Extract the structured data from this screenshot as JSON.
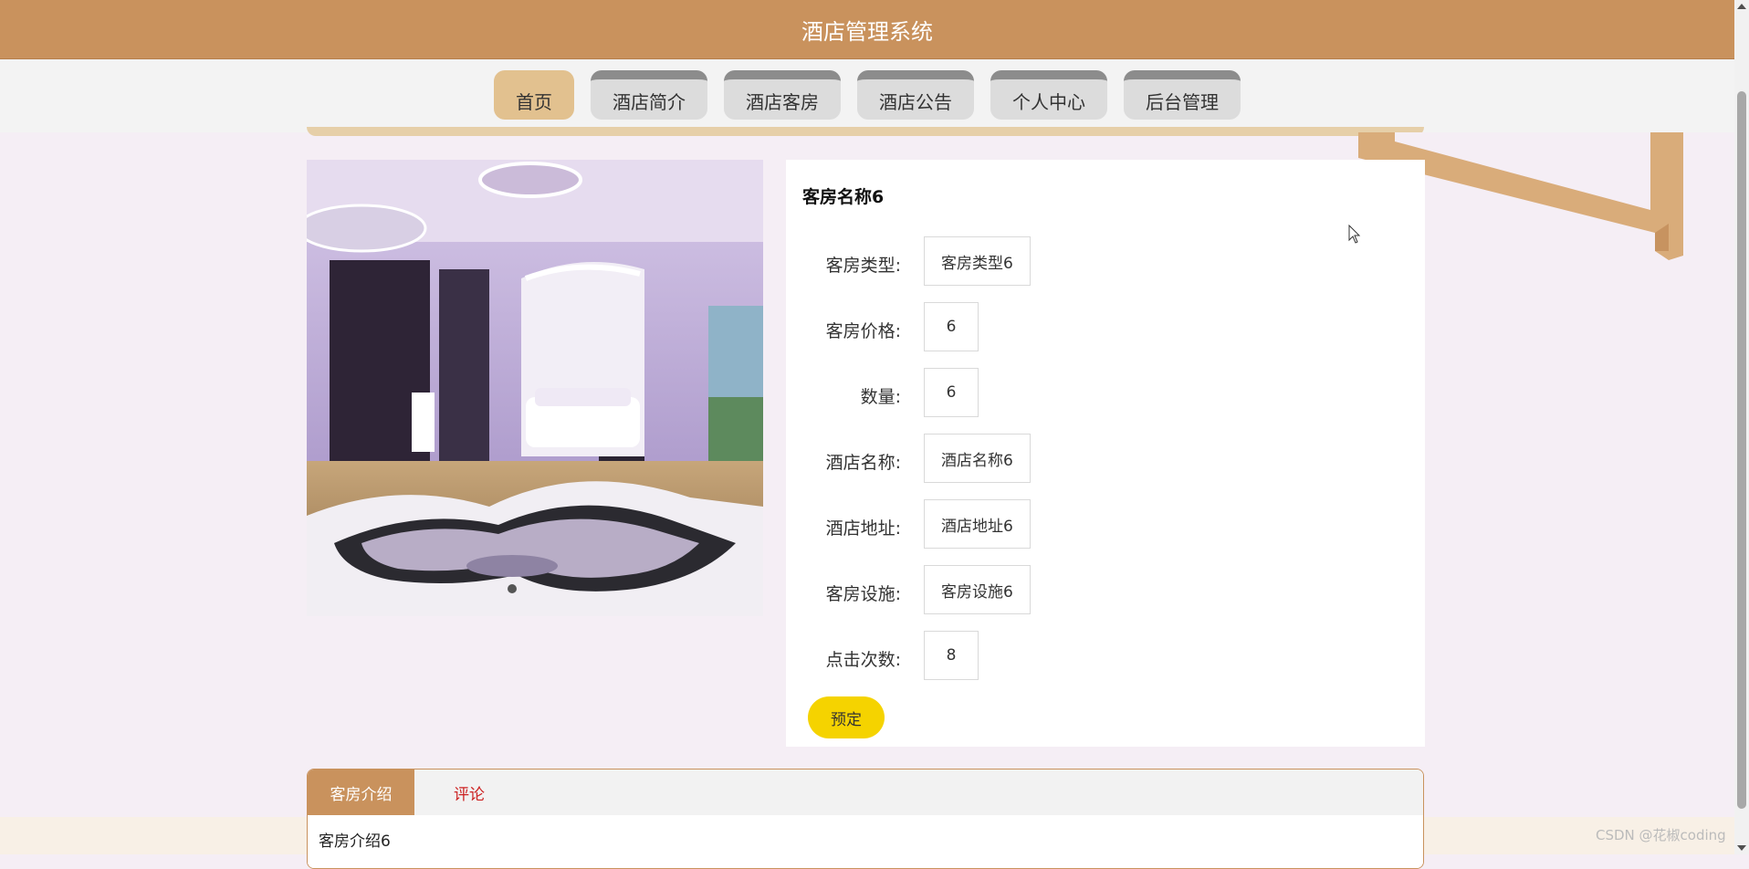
{
  "header": {
    "title": "酒店管理系统"
  },
  "nav": {
    "items": [
      {
        "label": "首页",
        "active": true
      },
      {
        "label": "酒店简介",
        "active": false
      },
      {
        "label": "酒店客房",
        "active": false
      },
      {
        "label": "酒店公告",
        "active": false
      },
      {
        "label": "个人中心",
        "active": false
      },
      {
        "label": "后台管理",
        "active": false
      }
    ]
  },
  "room": {
    "name": "客房名称6",
    "fields": [
      {
        "label": "客房类型:",
        "value": "客房类型6"
      },
      {
        "label": "客房价格:",
        "value": "6"
      },
      {
        "label": "数量:",
        "value": "6"
      },
      {
        "label": "酒店名称:",
        "value": "酒店名称6"
      },
      {
        "label": "酒店地址:",
        "value": "酒店地址6"
      },
      {
        "label": "客房设施:",
        "value": "客房设施6"
      },
      {
        "label": "点击次数:",
        "value": "8"
      }
    ],
    "book_label": "预定"
  },
  "tabs": {
    "items": [
      {
        "label": "客房介绍",
        "active": true
      },
      {
        "label": "评论",
        "active": false
      }
    ],
    "content": "客房介绍6"
  },
  "watermark": "CSDN @花椒coding",
  "colors": {
    "header": "#c9925d",
    "nav_active": "#e2c18f",
    "nav_inactive": "#dcdcdc",
    "book_button": "#f5d300",
    "comment_tab": "#cc2222"
  }
}
